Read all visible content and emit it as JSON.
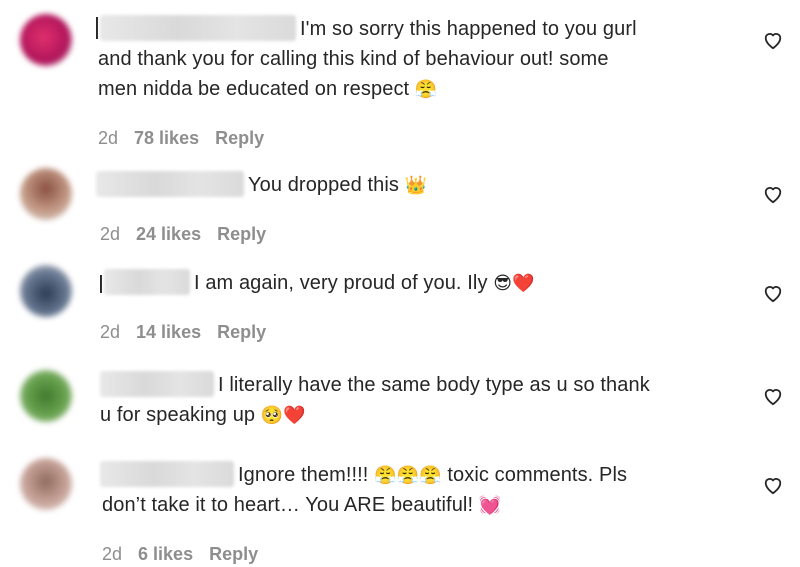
{
  "comments": [
    {
      "line1": "I'm so sorry this happened to you gurl",
      "line2": "and thank you for calling this kind of behaviour out! some",
      "line3": "men nidda be educated on respect",
      "emoji": "😤",
      "time": "2d",
      "likes": "78 likes",
      "reply": "Reply",
      "avatar_color": "#d1206a"
    },
    {
      "line1": "You dropped this",
      "emoji": "👑",
      "time": "2d",
      "likes": "24 likes",
      "reply": "Reply",
      "avatar_color": "#b08068"
    },
    {
      "line1": "I am again, very proud of you. Ily",
      "emoji": "😎❤️",
      "time": "2d",
      "likes": "14 likes",
      "reply": "Reply",
      "avatar_color": "#4a5a72"
    },
    {
      "line1": "I literally have the same body type as u so thank",
      "line2": "u for speaking up",
      "emoji": "🥺❤️",
      "time": "2d",
      "likes": "",
      "reply": "",
      "avatar_color": "#4f8a3c"
    },
    {
      "line1": "Ignore them!!!!",
      "emoji_mid": "😤😤😤",
      "line1b": "toxic comments. Pls",
      "line2": "don’t take it to heart… You ARE beautiful!",
      "emoji": "💓",
      "time": "2d",
      "likes": "6 likes",
      "reply": "Reply",
      "avatar_color": "#a88378"
    }
  ],
  "icons": {
    "like": "heart-outline-icon"
  }
}
